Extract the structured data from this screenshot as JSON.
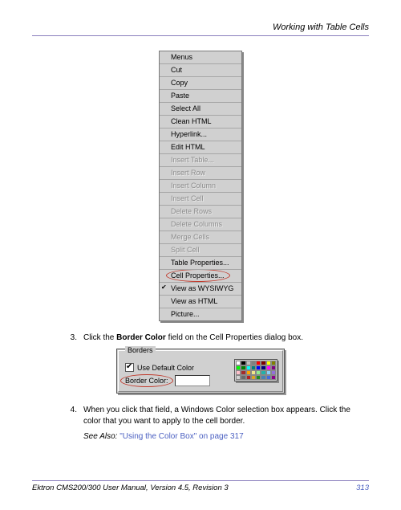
{
  "header": {
    "title": "Working with Table Cells"
  },
  "menu": {
    "items": [
      {
        "label": "Menus",
        "disabled": false,
        "checked": false,
        "circled": false
      },
      {
        "label": "Cut",
        "disabled": false,
        "checked": false,
        "circled": false
      },
      {
        "label": "Copy",
        "disabled": false,
        "checked": false,
        "circled": false
      },
      {
        "label": "Paste",
        "disabled": false,
        "checked": false,
        "circled": false
      },
      {
        "label": "Select All",
        "disabled": false,
        "checked": false,
        "circled": false
      },
      {
        "label": "Clean HTML",
        "disabled": false,
        "checked": false,
        "circled": false
      },
      {
        "label": "Hyperlink...",
        "disabled": false,
        "checked": false,
        "circled": false
      },
      {
        "label": "Edit HTML",
        "disabled": false,
        "checked": false,
        "circled": false
      },
      {
        "label": "Insert Table...",
        "disabled": true,
        "checked": false,
        "circled": false
      },
      {
        "label": "Insert Row",
        "disabled": true,
        "checked": false,
        "circled": false
      },
      {
        "label": "Insert Column",
        "disabled": true,
        "checked": false,
        "circled": false
      },
      {
        "label": "Insert Cell",
        "disabled": true,
        "checked": false,
        "circled": false
      },
      {
        "label": "Delete Rows",
        "disabled": true,
        "checked": false,
        "circled": false
      },
      {
        "label": "Delete Columns",
        "disabled": true,
        "checked": false,
        "circled": false
      },
      {
        "label": "Merge Cells",
        "disabled": true,
        "checked": false,
        "circled": false
      },
      {
        "label": "Split Cell",
        "disabled": true,
        "checked": false,
        "circled": false
      },
      {
        "label": "Table Properties...",
        "disabled": false,
        "checked": false,
        "circled": false
      },
      {
        "label": "Cell Properties...",
        "disabled": false,
        "checked": false,
        "circled": true
      },
      {
        "label": "View as WYSIWYG",
        "disabled": false,
        "checked": true,
        "circled": false
      },
      {
        "label": "View as HTML",
        "disabled": false,
        "checked": false,
        "circled": false
      },
      {
        "label": "Picture...",
        "disabled": false,
        "checked": false,
        "circled": false
      }
    ]
  },
  "steps": {
    "s3": {
      "num": "3.",
      "prefix": "Click the ",
      "bold": "Border Color",
      "suffix": " field on the Cell Properties dialog box."
    },
    "s4": {
      "num": "4.",
      "text": "When you click that field, a Windows Color selection box appears. Click the color that you want to apply to the cell border."
    }
  },
  "borders_panel": {
    "legend": "Borders",
    "use_default_label": "Use Default Color",
    "use_default_checked": true,
    "border_color_label": "Border Color:",
    "palette": [
      "#ffffff",
      "#000000",
      "#c0c0c0",
      "#808080",
      "#ff0000",
      "#800000",
      "#ffff00",
      "#808000",
      "#00ff00",
      "#008000",
      "#00ffff",
      "#008080",
      "#0000ff",
      "#000080",
      "#ff00ff",
      "#800080",
      "#ffc0cb",
      "#a52a2a",
      "#ffa500",
      "#f0e68c",
      "#90ee90",
      "#20b2aa",
      "#87cefa",
      "#9370db",
      "#d3d3d3",
      "#696969",
      "#b22222",
      "#daa520",
      "#228b22",
      "#4682b4",
      "#4169e1",
      "#8b008b"
    ]
  },
  "see_also": {
    "label": "See Also: ",
    "link": "\"Using the Color Box\" on page 317"
  },
  "footer": {
    "text": "Ektron CMS200/300 User Manual, Version 4.5, Revision 3",
    "page": "313"
  }
}
